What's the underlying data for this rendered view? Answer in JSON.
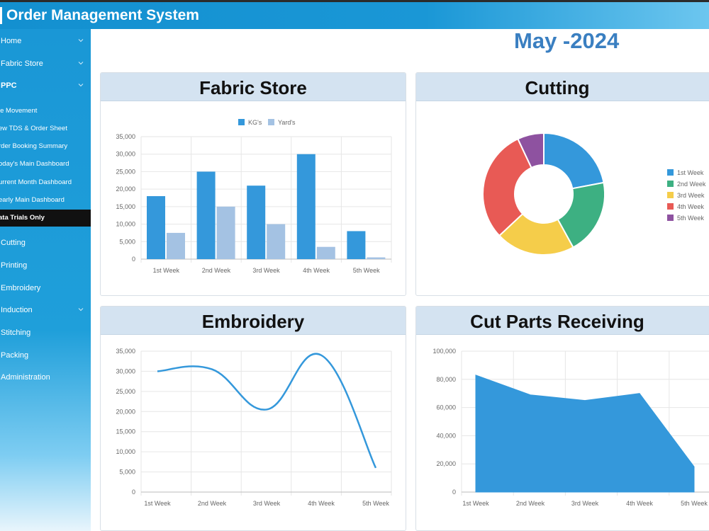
{
  "header": {
    "title": "Order Management System"
  },
  "sidebar": {
    "items": [
      {
        "label": "Home",
        "chevron": true
      },
      {
        "label": "Fabric Store",
        "chevron": true
      },
      {
        "label": "PPC",
        "chevron": true
      }
    ],
    "sub_items": [
      {
        "label": "le Movement",
        "active": false
      },
      {
        "label": "ew TDS & Order Sheet",
        "active": false
      },
      {
        "label": "rder Booking Summary",
        "active": false
      },
      {
        "label": "oday's Main Dashboard",
        "active": false
      },
      {
        "label": "urrent Month Dashboard",
        "active": false
      },
      {
        "label": "early Main Dashboard",
        "active": false
      },
      {
        "label": "ata Trials Only",
        "active": true
      }
    ],
    "items2": [
      {
        "label": "Cutting",
        "chevron": false
      },
      {
        "label": "Printing",
        "chevron": false
      },
      {
        "label": "Embroidery",
        "chevron": false
      },
      {
        "label": "Induction",
        "chevron": true
      },
      {
        "label": "Stitching",
        "chevron": false
      },
      {
        "label": "Packing",
        "chevron": false
      },
      {
        "label": "Administration",
        "chevron": false
      }
    ]
  },
  "month_label": "May -2024",
  "cards": {
    "fabric_store": "Fabric Store",
    "cutting": "Cutting",
    "embroidery": "Embroidery",
    "cut_parts": "Cut Parts Receiving"
  },
  "colors": {
    "blue": "#3498db",
    "light_blue": "#a4c2e3",
    "green": "#3db082",
    "yellow": "#f5cd4a",
    "red": "#e85a55",
    "purple": "#8e52a0"
  },
  "chart_data": [
    {
      "type": "bar",
      "title": "Fabric Store",
      "categories": [
        "1st Week",
        "2nd Week",
        "3rd Week",
        "4th Week",
        "5th Week"
      ],
      "series": [
        {
          "name": "KG's",
          "values": [
            18000,
            25000,
            21000,
            30000,
            8000
          ]
        },
        {
          "name": "Yard's",
          "values": [
            7500,
            15000,
            10000,
            3500,
            500
          ]
        }
      ],
      "yticks": [
        "0",
        "5,000",
        "10,000",
        "15,000",
        "20,000",
        "25,000",
        "30,000",
        "35,000"
      ],
      "ylim": [
        0,
        35000
      ],
      "legend": "top"
    },
    {
      "type": "pie",
      "title": "Cutting",
      "labels": [
        "1st Week",
        "2nd Week",
        "3rd Week",
        "4th Week",
        "5th Week"
      ],
      "values": [
        22,
        20,
        21,
        30,
        7
      ],
      "legend": "right"
    },
    {
      "type": "line",
      "title": "Embroidery",
      "categories": [
        "1st Week",
        "2nd Week",
        "3rd Week",
        "4th Week",
        "5th Week"
      ],
      "values": [
        30000,
        30500,
        20500,
        34000,
        6000
      ],
      "yticks": [
        "0",
        "5,000",
        "10,000",
        "15,000",
        "20,000",
        "25,000",
        "30,000",
        "35,000"
      ],
      "ylim": [
        0,
        35000
      ]
    },
    {
      "type": "area",
      "title": "Cut Parts Receiving",
      "categories": [
        "1st Week",
        "2nd Week",
        "3rd Week",
        "4th Week",
        "5th Week"
      ],
      "values": [
        83000,
        69000,
        65000,
        70000,
        18000
      ],
      "yticks": [
        "0",
        "20,000",
        "40,000",
        "60,000",
        "80,000",
        "100,000"
      ],
      "ylim": [
        0,
        100000
      ]
    }
  ]
}
